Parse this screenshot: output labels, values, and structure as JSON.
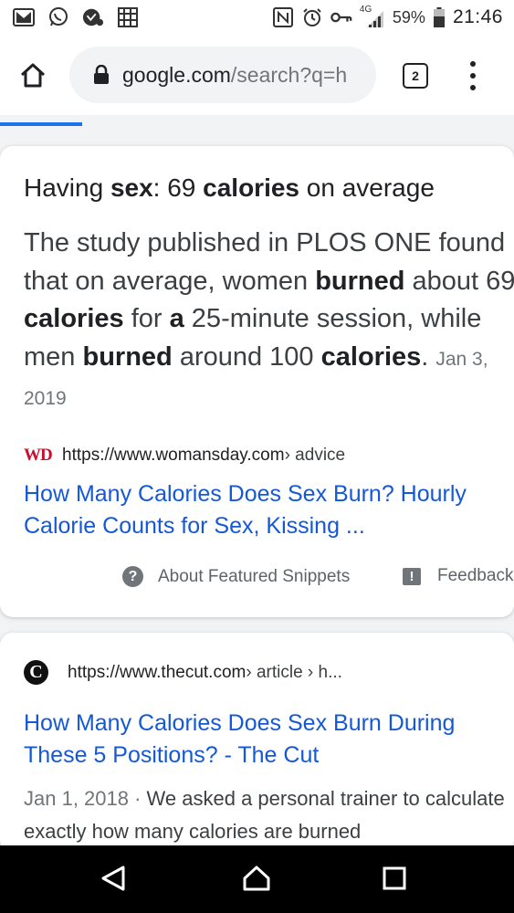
{
  "status_bar": {
    "left_icons": [
      "gmail-icon",
      "whatsapp-icon",
      "vpn-key-icon",
      "app-icon"
    ],
    "right_icons": [
      "nfc-icon",
      "alarm-icon",
      "key-icon",
      "signal-icon",
      "battery-icon"
    ],
    "network": "4G",
    "battery": "59%",
    "time": "21:46"
  },
  "toolbar": {
    "url_domain": "google.com",
    "url_path": "/search?q=h",
    "tab_count": "2"
  },
  "featured": {
    "heading_pre": "Having ",
    "heading_b1": "sex",
    "heading_mid": ": 69 ",
    "heading_b2": "calories",
    "heading_post": " on average",
    "body_1": "The study published in PLOS ONE found that on average, women ",
    "body_b1": "burned",
    "body_2": " about 69 ",
    "body_b2": "calories",
    "body_3": " for ",
    "body_b3": "a",
    "body_4": " 25-minute session, while men ",
    "body_b4": "burned",
    "body_5": " around 100 ",
    "body_b5": "calories",
    "body_6": ".",
    "date": "Jan 3, 2019",
    "source_logo": "WD",
    "source_url": "https://www.womansday.com",
    "source_path": " › advice",
    "title": "How Many Calories Does Sex Burn? Hourly Calorie Counts for Sex, Kissing ...",
    "about_label": "About Featured Snippets",
    "feedback_label": "Feedback"
  },
  "result2": {
    "logo": "C",
    "source_url": "https://www.thecut.com",
    "source_path": " › article › h...",
    "title": "How Many Calories Does Sex Burn During These 5 Positions? - The Cut",
    "date": "Jan 1, 2018",
    "separator": " · ",
    "snippet": "We asked a personal trainer to calculate exactly how many calories are burned"
  },
  "colors": {
    "link": "#1558d6",
    "progress": "#1a73e8",
    "womansday_red": "#c8102e"
  }
}
